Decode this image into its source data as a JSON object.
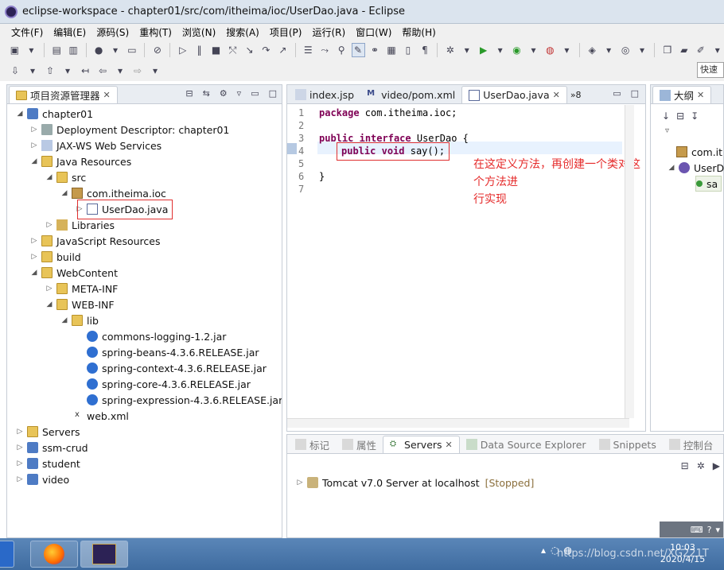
{
  "window": {
    "title": "eclipse-workspace - chapter01/src/com/itheima/ioc/UserDao.java - Eclipse"
  },
  "menu": [
    "文件(F)",
    "编辑(E)",
    "源码(S)",
    "重构(T)",
    "浏览(N)",
    "搜索(A)",
    "项目(P)",
    "运行(R)",
    "窗口(W)",
    "帮助(H)"
  ],
  "quick_access": "快速",
  "explorer": {
    "tab": "项目资源管理器",
    "items": [
      {
        "label": "chapter01"
      },
      {
        "label": "Deployment Descriptor: chapter01"
      },
      {
        "label": "JAX-WS Web Services"
      },
      {
        "label": "Java Resources"
      },
      {
        "label": "src"
      },
      {
        "label": "com.itheima.ioc"
      },
      {
        "label": "UserDao.java"
      },
      {
        "label": "Libraries"
      },
      {
        "label": "JavaScript Resources"
      },
      {
        "label": "build"
      },
      {
        "label": "WebContent"
      },
      {
        "label": "META-INF"
      },
      {
        "label": "WEB-INF"
      },
      {
        "label": "lib"
      },
      {
        "label": "commons-logging-1.2.jar"
      },
      {
        "label": "spring-beans-4.3.6.RELEASE.jar"
      },
      {
        "label": "spring-context-4.3.6.RELEASE.jar"
      },
      {
        "label": "spring-core-4.3.6.RELEASE.jar"
      },
      {
        "label": "spring-expression-4.3.6.RELEASE.jar"
      },
      {
        "label": "web.xml"
      },
      {
        "label": "Servers"
      },
      {
        "label": "ssm-crud"
      },
      {
        "label": "student"
      },
      {
        "label": "video"
      }
    ]
  },
  "editor": {
    "tabs": [
      {
        "label": "index.jsp"
      },
      {
        "label": "video/pom.xml"
      },
      {
        "label": "UserDao.java"
      }
    ],
    "overflow": "»8",
    "line_numbers": [
      "1",
      "2",
      "3",
      "4",
      "5",
      "6",
      "7"
    ],
    "lines": {
      "l1_kw": "package",
      "l1_rest": " com.itheima.ioc;",
      "l3_kw1": "public",
      "l3_kw2": "interface",
      "l3_rest": " UserDao {",
      "l4_kw1": "public",
      "l4_kw2": "void",
      "l4_rest": " say();",
      "l6": "}"
    },
    "annotation_line1": "在这定义方法，再创建一个类对这个方法进",
    "annotation_line2": "行实现"
  },
  "outline": {
    "tab": "大纲",
    "item1": "com.it",
    "item2": "UserD",
    "item3": "sa"
  },
  "bottom": {
    "tabs": [
      {
        "label": "标记"
      },
      {
        "label": "属性"
      },
      {
        "label": "Servers"
      },
      {
        "label": "Data Source Explorer"
      },
      {
        "label": "Snippets"
      },
      {
        "label": "控制台"
      }
    ],
    "server_name": "Tomcat v7.0 Server at localhost",
    "server_status": "[Stopped]"
  },
  "taskbar": {
    "time": "10:03",
    "date": "2020/4/15",
    "watermark": "https://blog.csdn.net/XG221T"
  },
  "colors": {
    "keyword": "#7f0055",
    "annotation": "#e52b2b",
    "status": "#8b6f3c"
  }
}
